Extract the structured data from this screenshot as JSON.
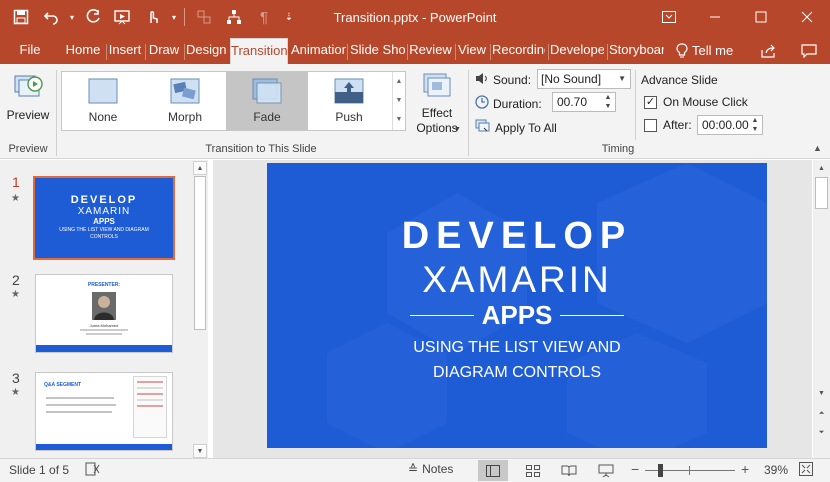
{
  "window": {
    "title": "Transition.pptx - PowerPoint",
    "quick_access": [
      "save-icon",
      "undo-icon",
      "undo-dropdown-icon",
      "redo-icon",
      "from-beginning-icon",
      "touch-mode-icon",
      "customize-icon"
    ],
    "controls": [
      "ribbon-options-icon",
      "minimize-icon",
      "maximize-icon",
      "close-icon"
    ]
  },
  "tabs": [
    {
      "label": "File"
    },
    {
      "label": "Home"
    },
    {
      "label": "Insert"
    },
    {
      "label": "Draw"
    },
    {
      "label": "Design"
    },
    {
      "label": "Transitions",
      "active": true
    },
    {
      "label": "Animations"
    },
    {
      "label": "Slide Show"
    },
    {
      "label": "Review"
    },
    {
      "label": "View"
    },
    {
      "label": "Recording"
    },
    {
      "label": "Developer"
    },
    {
      "label": "Storyboarding"
    }
  ],
  "tell_me": "Tell me",
  "ribbon": {
    "preview": {
      "button": "Preview",
      "group": "Preview"
    },
    "transitions": {
      "group": "Transition to This Slide",
      "items": [
        {
          "label": "None"
        },
        {
          "label": "Morph"
        },
        {
          "label": "Fade",
          "selected": true
        },
        {
          "label": "Push"
        }
      ],
      "effect_options": "Effect Options"
    },
    "timing": {
      "group": "Timing",
      "sound_label": "Sound:",
      "sound_value": "[No Sound]",
      "duration_label": "Duration:",
      "duration_value": "00.70",
      "apply_all": "Apply To All",
      "advance_slide": "Advance Slide",
      "on_mouse_click": "On Mouse Click",
      "on_mouse_click_checked": true,
      "after_label": "After:",
      "after_checked": false,
      "after_value": "00:00.00"
    }
  },
  "slides": [
    {
      "number": "1",
      "active": true,
      "title1": "DEVELOP",
      "title2": "XAMARIN",
      "title3": "APPS",
      "subtitle": "USING THE LIST VIEW AND DIAGRAM CONTROLS"
    },
    {
      "number": "2",
      "heading": "PRESENTER:",
      "name": "Juma Mohamed"
    },
    {
      "number": "3",
      "heading": "Q&A SEGMENT"
    }
  ],
  "main_slide": {
    "line1": "DEVELOP",
    "line2": "XAMARIN",
    "line3": "APPS",
    "line4": "USING THE LIST VIEW AND",
    "line5": "DIAGRAM CONTROLS",
    "background": "#1e5cd6"
  },
  "status": {
    "slide_info": "Slide 1 of 5",
    "notes": "Notes",
    "zoom": "39%"
  },
  "colors": {
    "brand": "#b7472a",
    "active_tab_text": "#b7472a",
    "slide_blue": "#1e5cd6",
    "thumbnail_border": "#e0693f"
  }
}
